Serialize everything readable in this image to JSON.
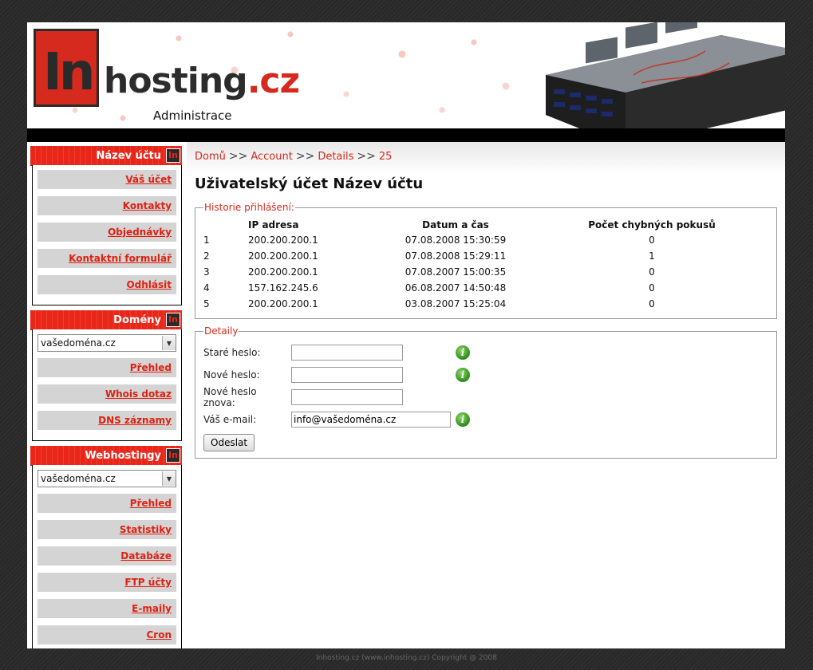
{
  "header": {
    "logo_mark": "In",
    "logo_name": "hosting",
    "logo_tld": ".cz",
    "subtitle": "Administrace"
  },
  "sidebar": {
    "account": {
      "title": "Název účtu",
      "items": [
        "Váš účet",
        "Kontakty",
        "Objednávky",
        "Kontaktní formulář",
        "Odhlásit"
      ]
    },
    "domains": {
      "title": "Domény",
      "selected": "vašedoména.cz",
      "items": [
        "Přehled",
        "Whois dotaz",
        "DNS záznamy"
      ]
    },
    "webhosting": {
      "title": "Webhostingy",
      "selected": "vašedoména.cz",
      "items": [
        "Přehled",
        "Statistiky",
        "Databáze",
        "FTP účty",
        "E-maily",
        "Cron"
      ]
    }
  },
  "breadcrumb": {
    "home": "Domů",
    "account": "Account",
    "details": "Details",
    "id": "25",
    "sep": ">>"
  },
  "page_title": "Uživatelský účet Název účtu",
  "history": {
    "legend": "Historie přihlášení:",
    "columns": [
      "",
      "IP adresa",
      "Datum a čas",
      "Počet chybných pokusů"
    ],
    "rows": [
      [
        "1",
        "200.200.200.1",
        "07.08.2008 15:30:59",
        "0"
      ],
      [
        "2",
        "200.200.200.1",
        "07.08.2008 15:29:11",
        "1"
      ],
      [
        "3",
        "200.200.200.1",
        "07.08.2007 15:00:35",
        "0"
      ],
      [
        "4",
        "157.162.245.6",
        "06.08.2007 14:50:48",
        "0"
      ],
      [
        "5",
        "200.200.200.1",
        "03.08.2007 15:25:04",
        "0"
      ]
    ]
  },
  "details": {
    "legend": "Detaily",
    "old_password_label": "Staré heslo:",
    "new_password_label": "Nové heslo:",
    "new_password_again_label": "Nové heslo znova:",
    "email_label": "Váš e-mail:",
    "email_value": "info@vašedoména.cz",
    "submit": "Odeslat"
  },
  "footer": "Inhosting.cz (www.inhosting.cz) Copyright @ 2008",
  "colors": {
    "accent": "#e8261a",
    "link": "#e02010"
  }
}
